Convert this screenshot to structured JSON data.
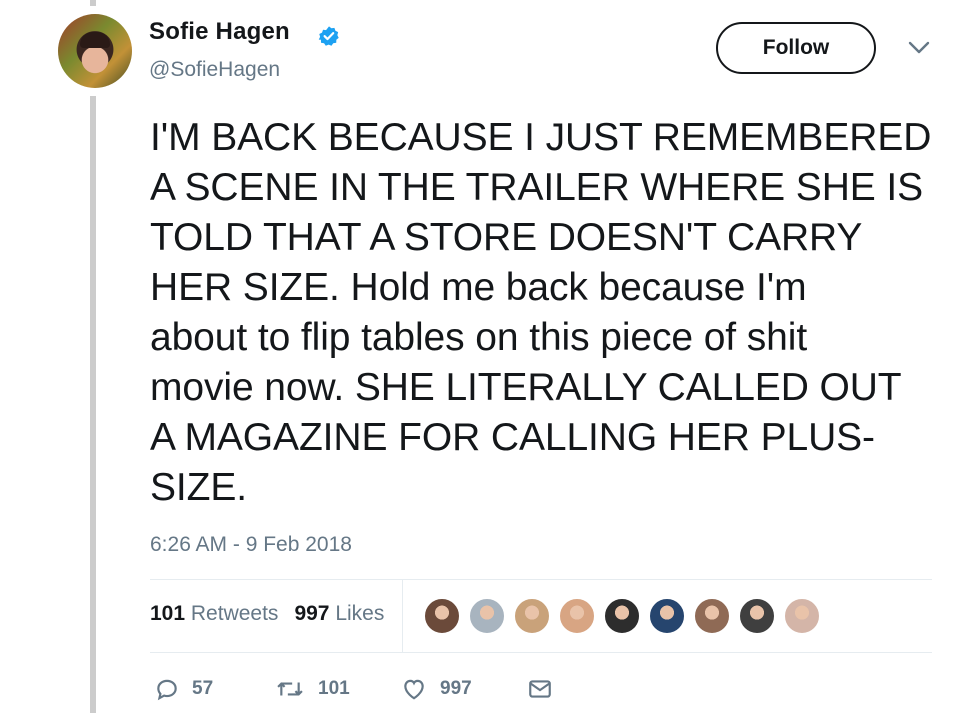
{
  "author": {
    "name": "Sofie Hagen",
    "handle": "@SofieHagen",
    "verified": true
  },
  "follow_label": "Follow",
  "tweet": {
    "text": "I'M BACK BECAUSE I JUST REMEMBERED\nA SCENE IN THE TRAILER WHERE SHE IS\nTOLD THAT A STORE DOESN'T CARRY\nHER SIZE. Hold me back because I'm\nabout to flip tables on this piece of shit\nmovie now. SHE LITERALLY CALLED OUT\nA MAGAZINE FOR CALLING HER PLUS-\nSIZE.",
    "timestamp": "6:26 AM - 9 Feb 2018"
  },
  "stats": {
    "retweets_count": "101",
    "retweets_label": "Retweets",
    "likes_count": "997",
    "likes_label": "Likes"
  },
  "liker_avatars": [
    {
      "name": "liker-avatar-1",
      "color": "#6b4a3a"
    },
    {
      "name": "liker-avatar-2",
      "color": "#a8b4bf"
    },
    {
      "name": "liker-avatar-3",
      "color": "#c9a27a"
    },
    {
      "name": "liker-avatar-4",
      "color": "#d8a583"
    },
    {
      "name": "liker-avatar-5",
      "color": "#2d2d2d"
    },
    {
      "name": "liker-avatar-6",
      "color": "#26456e"
    },
    {
      "name": "liker-avatar-7",
      "color": "#8f6a55"
    },
    {
      "name": "liker-avatar-8",
      "color": "#3f3f3f"
    },
    {
      "name": "liker-avatar-9",
      "color": "#d4b5a8"
    }
  ],
  "actions": {
    "reply_count": "57",
    "retweet_count": "101",
    "like_count": "997"
  },
  "colors": {
    "text": "#14171a",
    "muted": "#657786",
    "verified_blue": "#1da1f2",
    "divider": "#e6ecf0"
  },
  "icons": [
    "verified-badge-icon",
    "chevron-down-icon",
    "reply-icon",
    "retweet-icon",
    "like-icon",
    "direct-message-icon"
  ]
}
